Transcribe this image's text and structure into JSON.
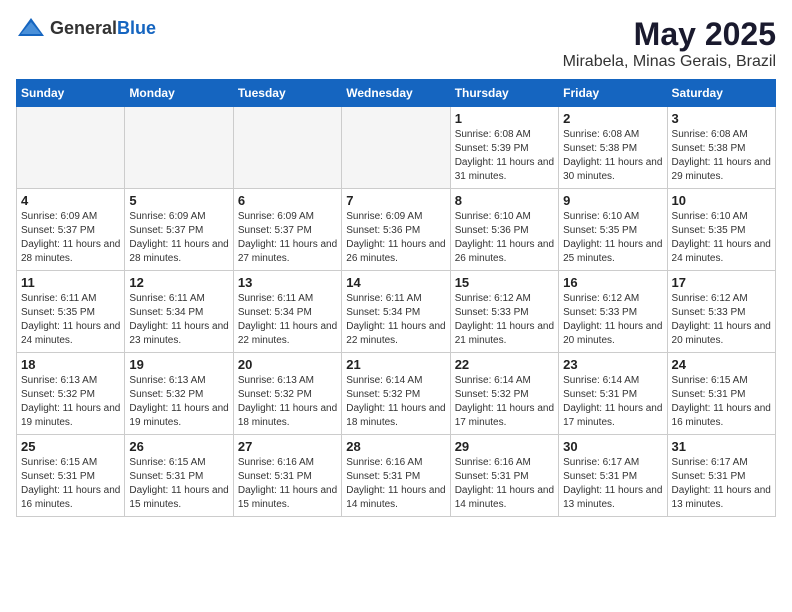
{
  "header": {
    "logo_general": "General",
    "logo_blue": "Blue",
    "month_title": "May 2025",
    "location": "Mirabela, Minas Gerais, Brazil"
  },
  "days_of_week": [
    "Sunday",
    "Monday",
    "Tuesday",
    "Wednesday",
    "Thursday",
    "Friday",
    "Saturday"
  ],
  "weeks": [
    [
      {
        "day": "",
        "empty": true
      },
      {
        "day": "",
        "empty": true
      },
      {
        "day": "",
        "empty": true
      },
      {
        "day": "",
        "empty": true
      },
      {
        "day": "1",
        "sunrise": "6:08 AM",
        "sunset": "5:39 PM",
        "daylight": "11 hours and 31 minutes."
      },
      {
        "day": "2",
        "sunrise": "6:08 AM",
        "sunset": "5:38 PM",
        "daylight": "11 hours and 30 minutes."
      },
      {
        "day": "3",
        "sunrise": "6:08 AM",
        "sunset": "5:38 PM",
        "daylight": "11 hours and 29 minutes."
      }
    ],
    [
      {
        "day": "4",
        "sunrise": "6:09 AM",
        "sunset": "5:37 PM",
        "daylight": "11 hours and 28 minutes."
      },
      {
        "day": "5",
        "sunrise": "6:09 AM",
        "sunset": "5:37 PM",
        "daylight": "11 hours and 28 minutes."
      },
      {
        "day": "6",
        "sunrise": "6:09 AM",
        "sunset": "5:37 PM",
        "daylight": "11 hours and 27 minutes."
      },
      {
        "day": "7",
        "sunrise": "6:09 AM",
        "sunset": "5:36 PM",
        "daylight": "11 hours and 26 minutes."
      },
      {
        "day": "8",
        "sunrise": "6:10 AM",
        "sunset": "5:36 PM",
        "daylight": "11 hours and 26 minutes."
      },
      {
        "day": "9",
        "sunrise": "6:10 AM",
        "sunset": "5:35 PM",
        "daylight": "11 hours and 25 minutes."
      },
      {
        "day": "10",
        "sunrise": "6:10 AM",
        "sunset": "5:35 PM",
        "daylight": "11 hours and 24 minutes."
      }
    ],
    [
      {
        "day": "11",
        "sunrise": "6:11 AM",
        "sunset": "5:35 PM",
        "daylight": "11 hours and 24 minutes."
      },
      {
        "day": "12",
        "sunrise": "6:11 AM",
        "sunset": "5:34 PM",
        "daylight": "11 hours and 23 minutes."
      },
      {
        "day": "13",
        "sunrise": "6:11 AM",
        "sunset": "5:34 PM",
        "daylight": "11 hours and 22 minutes."
      },
      {
        "day": "14",
        "sunrise": "6:11 AM",
        "sunset": "5:34 PM",
        "daylight": "11 hours and 22 minutes."
      },
      {
        "day": "15",
        "sunrise": "6:12 AM",
        "sunset": "5:33 PM",
        "daylight": "11 hours and 21 minutes."
      },
      {
        "day": "16",
        "sunrise": "6:12 AM",
        "sunset": "5:33 PM",
        "daylight": "11 hours and 20 minutes."
      },
      {
        "day": "17",
        "sunrise": "6:12 AM",
        "sunset": "5:33 PM",
        "daylight": "11 hours and 20 minutes."
      }
    ],
    [
      {
        "day": "18",
        "sunrise": "6:13 AM",
        "sunset": "5:32 PM",
        "daylight": "11 hours and 19 minutes."
      },
      {
        "day": "19",
        "sunrise": "6:13 AM",
        "sunset": "5:32 PM",
        "daylight": "11 hours and 19 minutes."
      },
      {
        "day": "20",
        "sunrise": "6:13 AM",
        "sunset": "5:32 PM",
        "daylight": "11 hours and 18 minutes."
      },
      {
        "day": "21",
        "sunrise": "6:14 AM",
        "sunset": "5:32 PM",
        "daylight": "11 hours and 18 minutes."
      },
      {
        "day": "22",
        "sunrise": "6:14 AM",
        "sunset": "5:32 PM",
        "daylight": "11 hours and 17 minutes."
      },
      {
        "day": "23",
        "sunrise": "6:14 AM",
        "sunset": "5:31 PM",
        "daylight": "11 hours and 17 minutes."
      },
      {
        "day": "24",
        "sunrise": "6:15 AM",
        "sunset": "5:31 PM",
        "daylight": "11 hours and 16 minutes."
      }
    ],
    [
      {
        "day": "25",
        "sunrise": "6:15 AM",
        "sunset": "5:31 PM",
        "daylight": "11 hours and 16 minutes."
      },
      {
        "day": "26",
        "sunrise": "6:15 AM",
        "sunset": "5:31 PM",
        "daylight": "11 hours and 15 minutes."
      },
      {
        "day": "27",
        "sunrise": "6:16 AM",
        "sunset": "5:31 PM",
        "daylight": "11 hours and 15 minutes."
      },
      {
        "day": "28",
        "sunrise": "6:16 AM",
        "sunset": "5:31 PM",
        "daylight": "11 hours and 14 minutes."
      },
      {
        "day": "29",
        "sunrise": "6:16 AM",
        "sunset": "5:31 PM",
        "daylight": "11 hours and 14 minutes."
      },
      {
        "day": "30",
        "sunrise": "6:17 AM",
        "sunset": "5:31 PM",
        "daylight": "11 hours and 13 minutes."
      },
      {
        "day": "31",
        "sunrise": "6:17 AM",
        "sunset": "5:31 PM",
        "daylight": "11 hours and 13 minutes."
      }
    ]
  ]
}
